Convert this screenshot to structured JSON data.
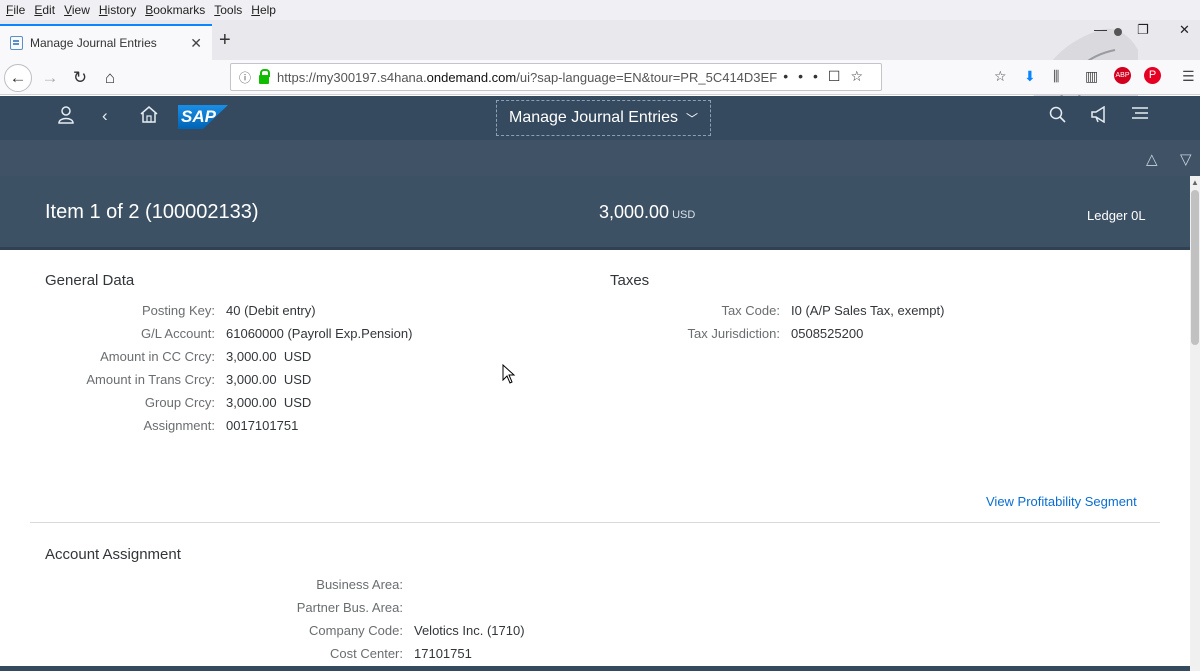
{
  "browser": {
    "menu": [
      "File",
      "Edit",
      "View",
      "History",
      "Bookmarks",
      "Tools",
      "Help"
    ],
    "tab_title": "Manage Journal Entries",
    "url_prefix": "https://my300197.s4hana.",
    "url_domain": "ondemand.com",
    "url_suffix": "/ui?sap-language=EN&tour=PR_5C414D3EF"
  },
  "shell": {
    "app_title": "Manage Journal Entries",
    "logo": "SAP"
  },
  "header": {
    "title": "Item 1 of 2 (100002133)",
    "amount": "3,000.00",
    "currency": "USD",
    "ledger": "Ledger 0L"
  },
  "general": {
    "title": "General Data",
    "fields": [
      {
        "label": "Posting Key:",
        "value": "40 (Debit entry)"
      },
      {
        "label": "G/L Account:",
        "value": "61060000 (Payroll Exp.Pension)"
      },
      {
        "label": "Amount in CC Crcy:",
        "value": "3,000.00  USD"
      },
      {
        "label": "Amount in Trans Crcy:",
        "value": "3,000.00  USD"
      },
      {
        "label": "Group Crcy:",
        "value": "3,000.00  USD"
      },
      {
        "label": "Assignment:",
        "value": "0017101751"
      }
    ]
  },
  "taxes": {
    "title": "Taxes",
    "fields": [
      {
        "label": "Tax Code:",
        "value": "I0 (A/P Sales Tax, exempt)"
      },
      {
        "label": "Tax Jurisdiction:",
        "value": "0508525200"
      }
    ]
  },
  "profitability_link": "View Profitability Segment",
  "account": {
    "title": "Account Assignment",
    "fields": [
      {
        "label": "Business Area:",
        "value": ""
      },
      {
        "label": "Partner Bus. Area:",
        "value": ""
      },
      {
        "label": "Company Code:",
        "value": "Velotics Inc. (1710)"
      },
      {
        "label": "Cost Center:",
        "value": "17101751"
      }
    ]
  }
}
